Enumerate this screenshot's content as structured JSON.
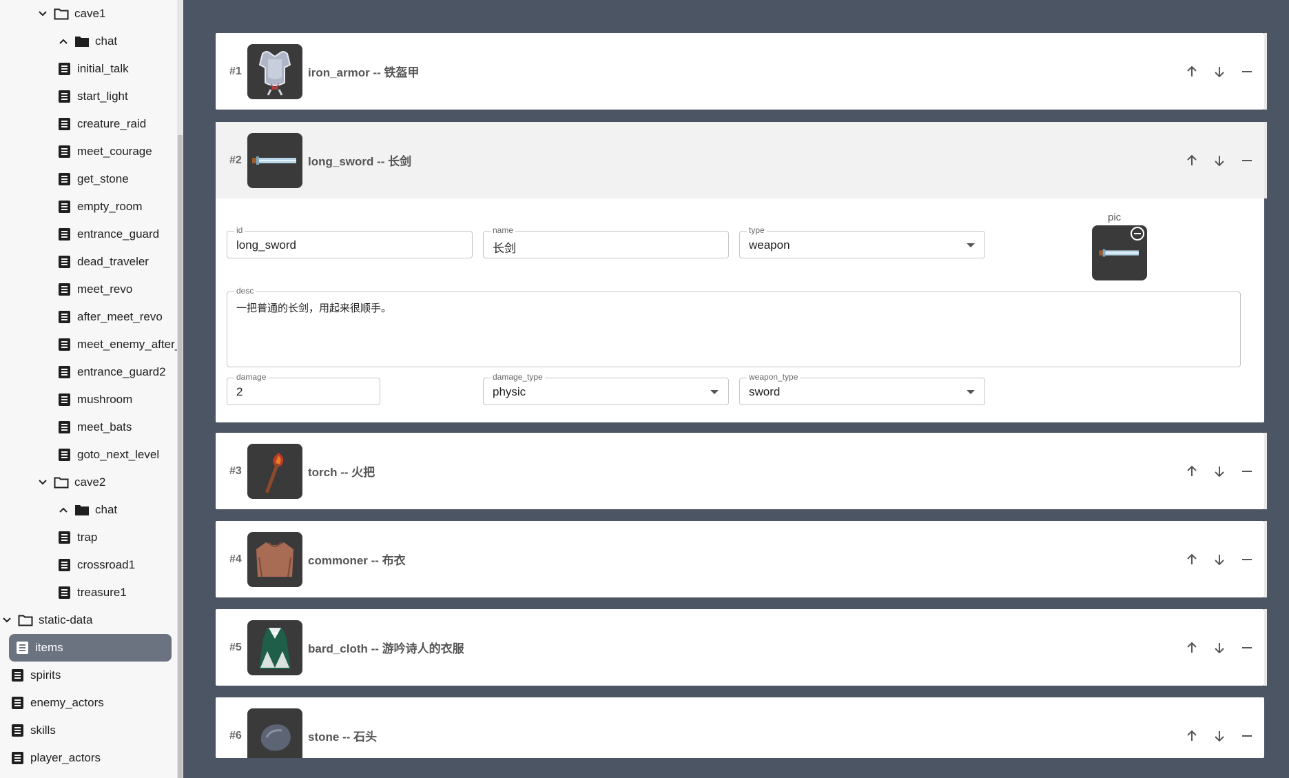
{
  "sidebar": {
    "tree": [
      {
        "label": "cave1",
        "kind": "folder-open",
        "chev": "down"
      },
      {
        "label": "chat",
        "kind": "folder-filled",
        "chev": "up"
      },
      {
        "label": "initial_talk",
        "kind": "doc"
      },
      {
        "label": "start_light",
        "kind": "doc"
      },
      {
        "label": "creature_raid",
        "kind": "doc"
      },
      {
        "label": "meet_courage",
        "kind": "doc"
      },
      {
        "label": "get_stone",
        "kind": "doc"
      },
      {
        "label": "empty_room",
        "kind": "doc"
      },
      {
        "label": "entrance_guard",
        "kind": "doc"
      },
      {
        "label": "dead_traveler",
        "kind": "doc"
      },
      {
        "label": "meet_revo",
        "kind": "doc"
      },
      {
        "label": "after_meet_revo",
        "kind": "doc"
      },
      {
        "label": "meet_enemy_after_r",
        "kind": "doc"
      },
      {
        "label": "entrance_guard2",
        "kind": "doc"
      },
      {
        "label": "mushroom",
        "kind": "doc"
      },
      {
        "label": "meet_bats",
        "kind": "doc"
      },
      {
        "label": "goto_next_level",
        "kind": "doc"
      },
      {
        "label": "cave2",
        "kind": "folder-open",
        "chev": "down"
      },
      {
        "label": "chat",
        "kind": "folder-filled",
        "chev": "up"
      },
      {
        "label": "trap",
        "kind": "doc"
      },
      {
        "label": "crossroad1",
        "kind": "doc"
      },
      {
        "label": "treasure1",
        "kind": "doc"
      },
      {
        "label": "static-data",
        "kind": "folder-open",
        "chev": "down"
      },
      {
        "label": "items",
        "kind": "doc",
        "selected": true
      },
      {
        "label": "spirits",
        "kind": "doc"
      },
      {
        "label": "enemy_actors",
        "kind": "doc"
      },
      {
        "label": "skills",
        "kind": "doc"
      },
      {
        "label": "player_actors",
        "kind": "doc"
      }
    ]
  },
  "items": [
    {
      "index": "#1",
      "title": "iron_armor -- 铁盔甲",
      "icon": "armor-icon"
    },
    {
      "index": "#2",
      "title": "long_sword -- 长剑",
      "icon": "sword-icon",
      "expanded": true
    },
    {
      "index": "#3",
      "title": "torch -- 火把",
      "icon": "torch-icon"
    },
    {
      "index": "#4",
      "title": "commoner -- 布衣",
      "icon": "cloth-icon"
    },
    {
      "index": "#5",
      "title": "bard_cloth -- 游吟诗人的衣服",
      "icon": "bard-cloth-icon"
    },
    {
      "index": "#6",
      "title": "stone -- 石头",
      "icon": "stone-icon"
    }
  ],
  "form": {
    "id_label": "id",
    "id_value": "long_sword",
    "name_label": "name",
    "name_value": "长剑",
    "type_label": "type",
    "type_value": "weapon",
    "pic_label": "pic",
    "desc_label": "desc",
    "desc_value": "一把普通的长剑，用起来很顺手。",
    "damage_label": "damage",
    "damage_value": "2",
    "damage_type_label": "damage_type",
    "damage_type_value": "physic",
    "weapon_type_label": "weapon_type",
    "weapon_type_value": "sword"
  },
  "colors": {
    "app_bg": "#4b5563",
    "sidebar_bg": "#f7f7f7",
    "selected_bg": "#6b7280",
    "thumb_bg": "#3a3a3a"
  }
}
